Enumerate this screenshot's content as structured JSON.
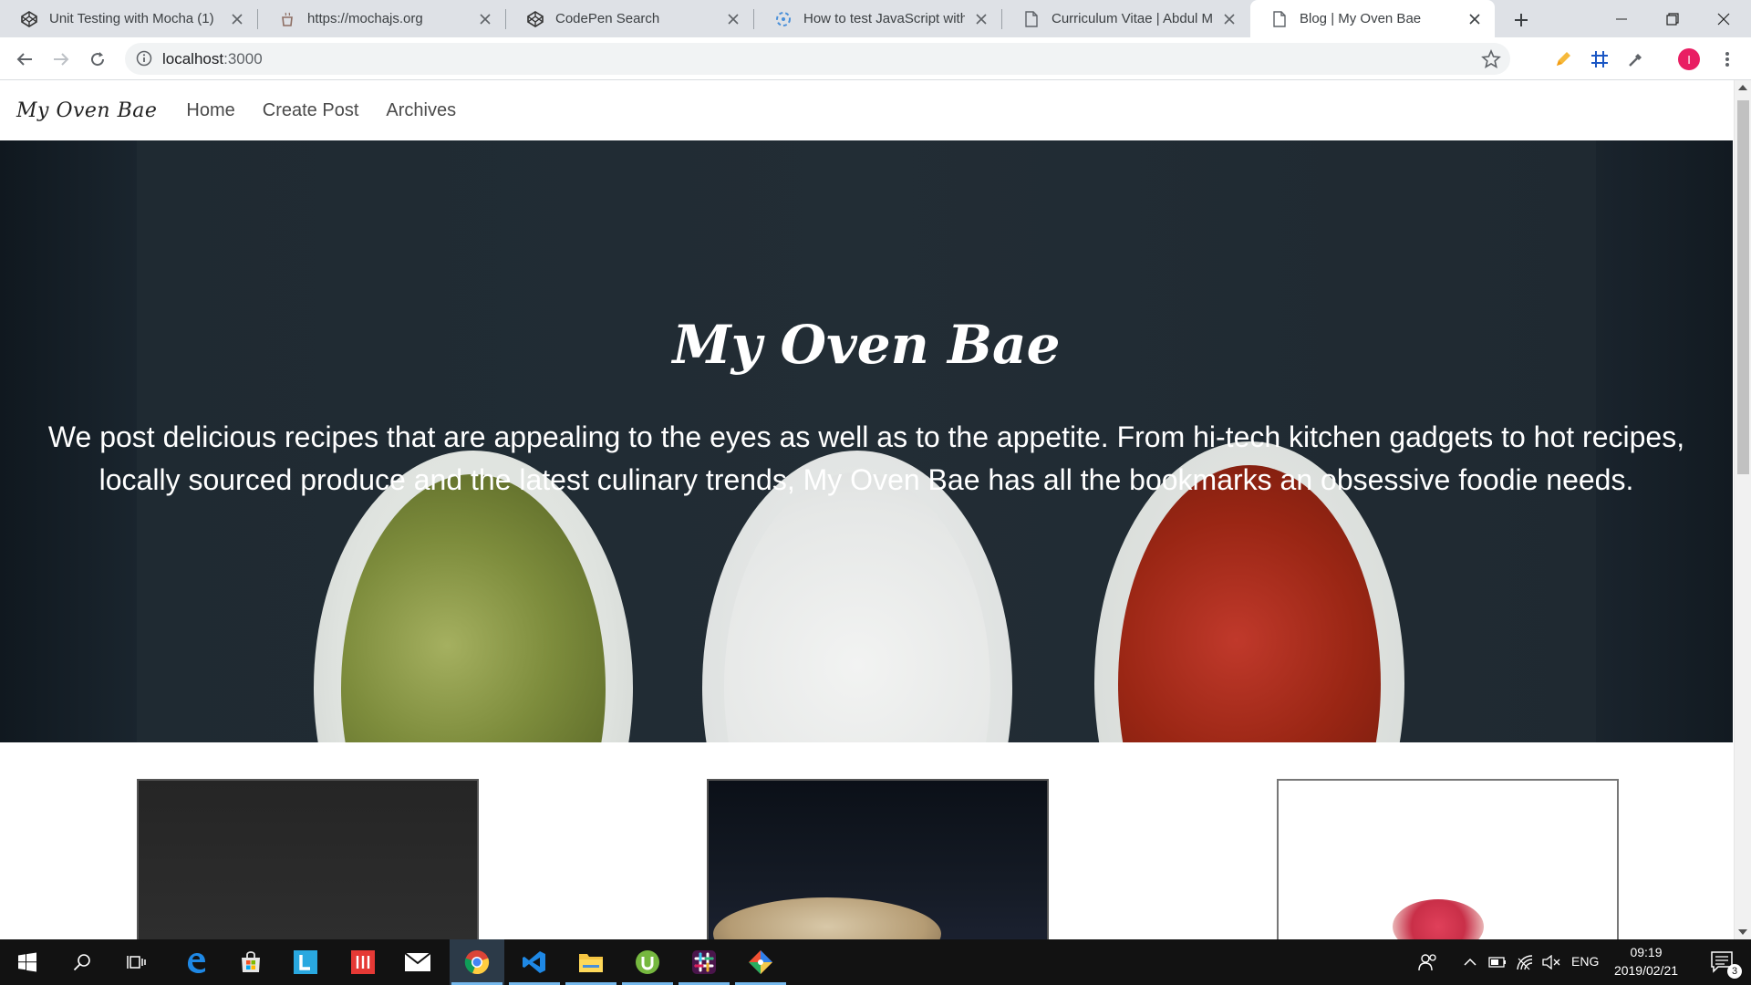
{
  "browser": {
    "tabs": [
      {
        "title": "Unit Testing with Mocha (1)",
        "icon": "codepen-icon"
      },
      {
        "title": "https://mochajs.org",
        "icon": "mocha-icon"
      },
      {
        "title": "CodePen Search",
        "icon": "codepen-icon"
      },
      {
        "title": "How to test JavaScript with M",
        "icon": "loading-icon"
      },
      {
        "title": "Curriculum Vitae | Abdul Mal",
        "icon": "document-icon"
      },
      {
        "title": "Blog | My Oven Bae",
        "icon": "document-icon",
        "active": true
      }
    ],
    "address": {
      "host": "localhost",
      "port": ":3000"
    },
    "profile_initial": "I"
  },
  "site": {
    "brand": "My Oven Bae",
    "nav": [
      "Home",
      "Create Post",
      "Archives"
    ],
    "hero": {
      "title": "My Oven Bae",
      "text": "We post delicious recipes that are appealing to the eyes as well as to the appetite. From hi-tech kitchen gadgets to hot recipes, locally sourced produce and the latest culinary trends, My Oven Bae has all the bookmarks an obsessive foodie needs."
    }
  },
  "taskbar": {
    "language": "ENG",
    "time": "09:19",
    "date": "2019/02/21",
    "notifications": "3",
    "apps": [
      "start-icon",
      "search-icon",
      "task-view-icon",
      "edge-icon",
      "store-icon",
      "l-app-icon",
      "red-app-icon",
      "mail-icon",
      "chrome-icon",
      "vscode-icon",
      "file-explorer-icon",
      "utorrent-icon",
      "slack-icon",
      "git-icon"
    ]
  },
  "colors": {
    "accent": "#76b9ed",
    "profile": "#e91e63",
    "hero_bg": "#1d2831"
  }
}
